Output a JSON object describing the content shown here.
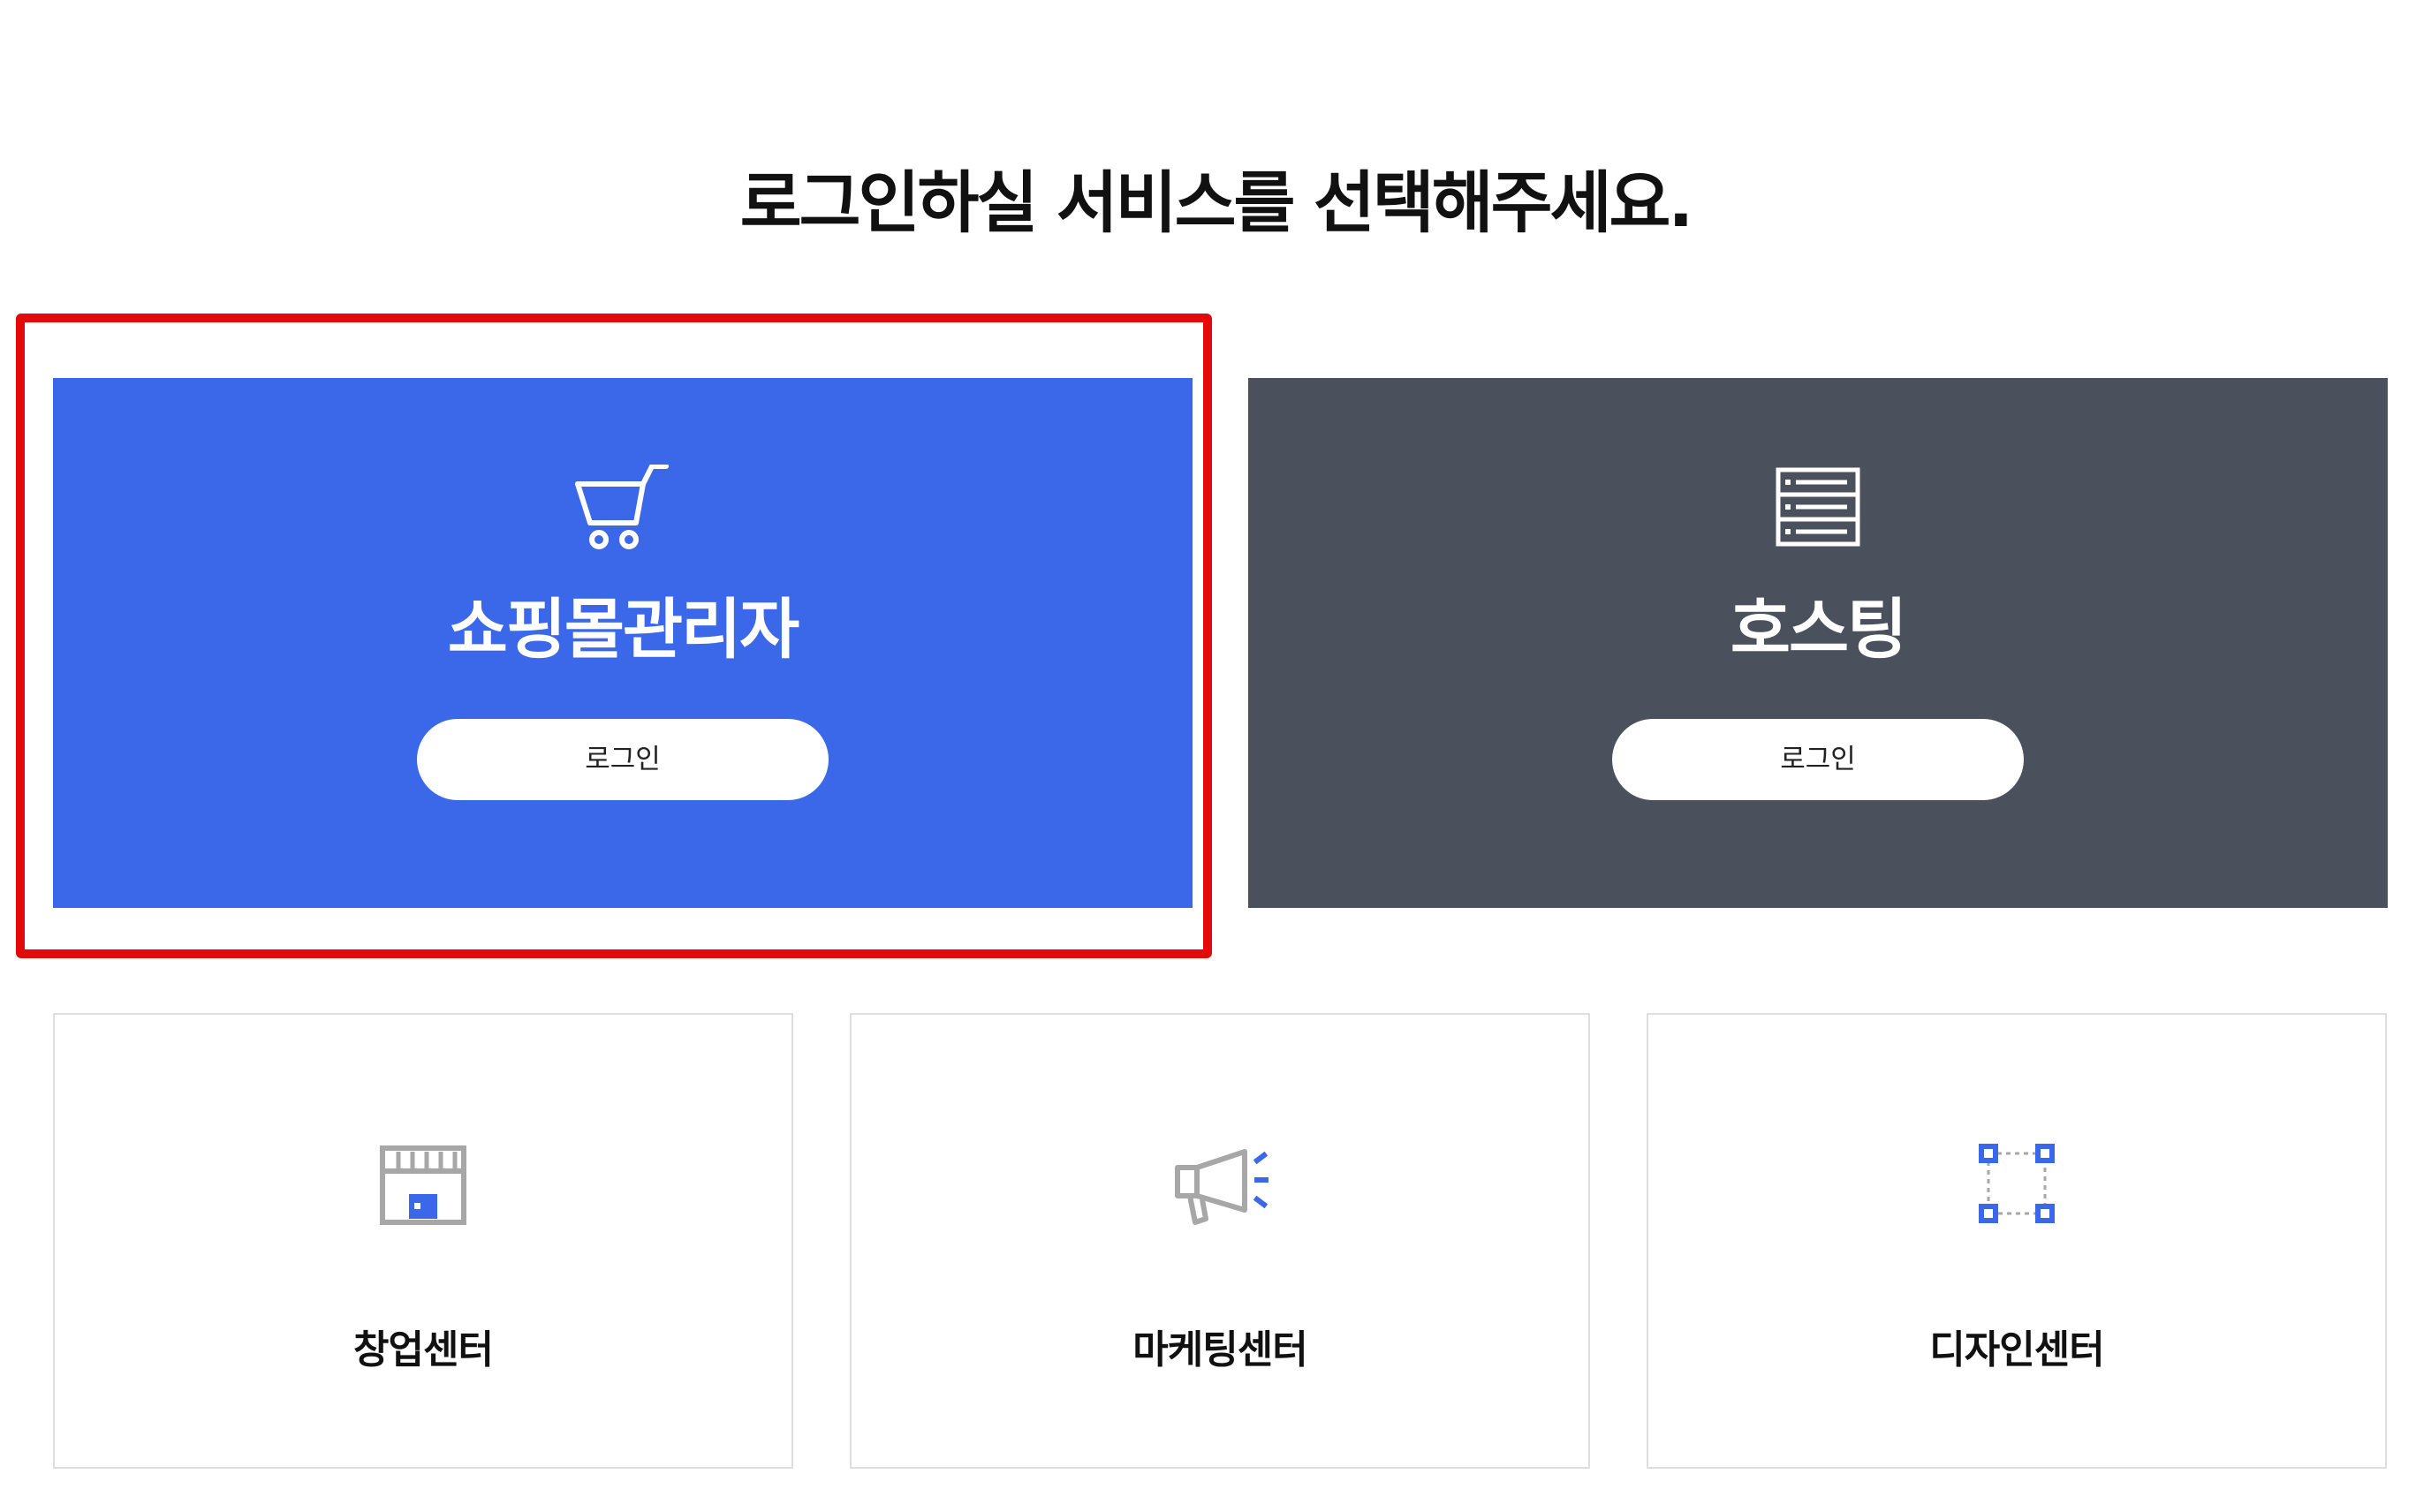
{
  "page": {
    "title": "로그인하실 서비스를 선택해주세요."
  },
  "big_cards": [
    {
      "id": "shop",
      "title": "쇼핑몰관리자",
      "button_label": "로그인",
      "icon": "shopping-cart-icon",
      "bg_color": "#3b68e8"
    },
    {
      "id": "hosting",
      "title": "호스팅",
      "button_label": "로그인",
      "icon": "server-icon",
      "bg_color": "#4a505c"
    }
  ],
  "small_cards": [
    {
      "id": "startup",
      "label": "창업센터",
      "icon": "storefront-icon"
    },
    {
      "id": "marketing",
      "label": "마케팅센터",
      "icon": "megaphone-icon"
    },
    {
      "id": "design",
      "label": "디자인센터",
      "icon": "selection-box-icon"
    }
  ],
  "colors": {
    "highlight": "#e20a0a",
    "accent_blue": "#3b68e8",
    "icon_gray": "#a7a7a7"
  }
}
